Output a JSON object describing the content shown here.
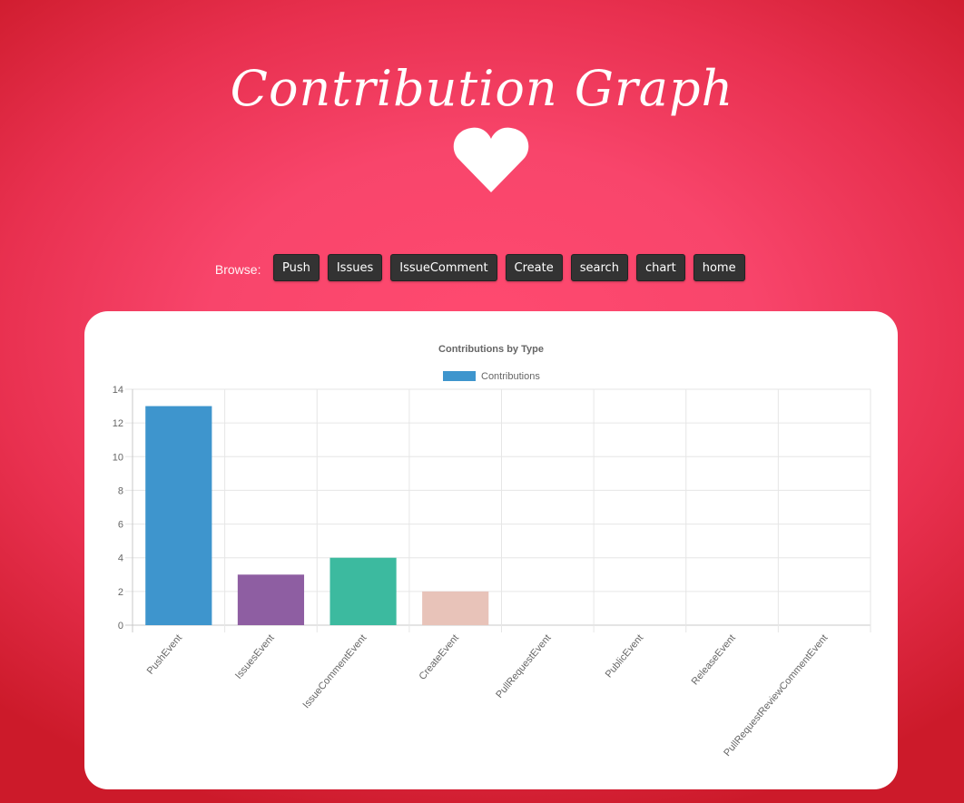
{
  "page": {
    "title": "Contribution Graph"
  },
  "nav": {
    "browse_label": "Browse:",
    "buttons": [
      "Push",
      "Issues",
      "IssueComment",
      "Create",
      "search",
      "chart",
      "home"
    ]
  },
  "colors": {
    "heart": "#ffffff",
    "button_bg": "#333333",
    "card_bg": "#ffffff"
  },
  "chart_data": {
    "type": "bar",
    "title": "Contributions by Type",
    "categories": [
      "PushEvent",
      "IssuesEvent",
      "IssueCommentEvent",
      "CreateEvent",
      "PullRequestEvent",
      "PublicEvent",
      "ReleaseEvent",
      "PullRequestReviewCommentEvent"
    ],
    "series": [
      {
        "name": "Contributions",
        "values": [
          13,
          3,
          4,
          2,
          0,
          0,
          0,
          0
        ]
      }
    ],
    "bar_colors": [
      "#3e95cd",
      "#8e5ea2",
      "#3cba9f",
      "#e8c3b9",
      "#c45850",
      "#3e95cd",
      "#8e5ea2",
      "#3cba9f"
    ],
    "legend_color": "#3e95cd",
    "ylim": [
      0,
      14
    ],
    "yticks": [
      0,
      2,
      4,
      6,
      8,
      10,
      12,
      14
    ],
    "grid": true,
    "legend": "top"
  }
}
